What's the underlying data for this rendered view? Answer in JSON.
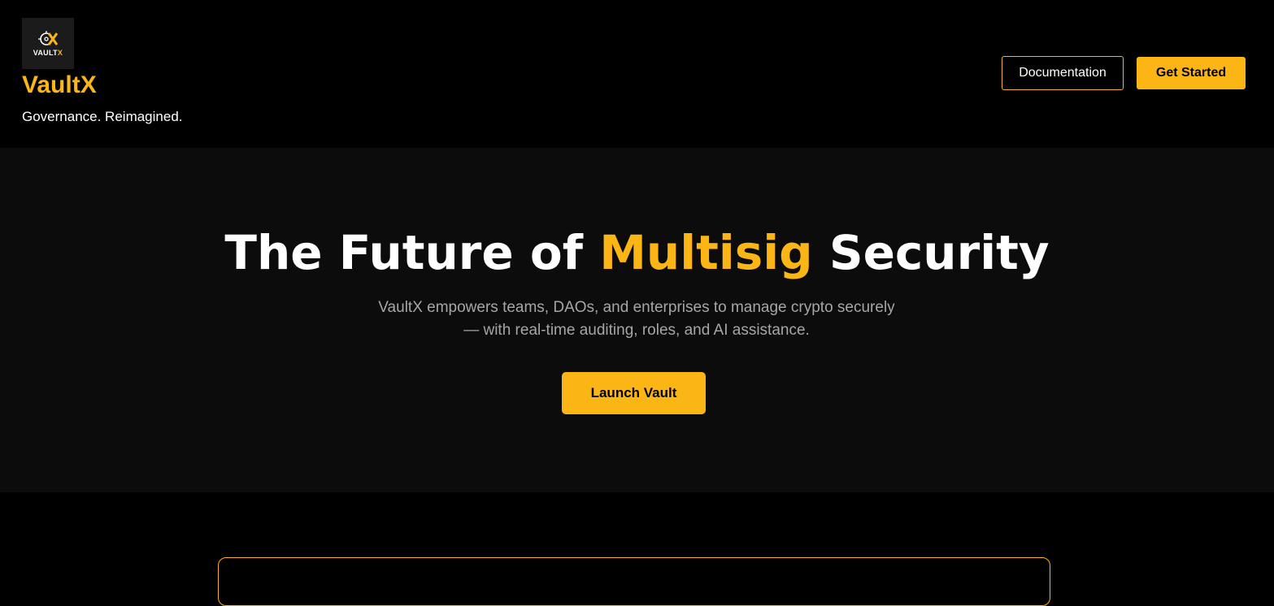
{
  "header": {
    "logo": {
      "icon": "vaultx-logo-icon",
      "text_main": "VAULT",
      "text_accent": "X"
    },
    "brand_name": "VaultX",
    "tagline": "Governance. Reimagined.",
    "nav": {
      "documentation_label": "Documentation",
      "get_started_label": "Get Started"
    }
  },
  "hero": {
    "title_before": "The Future of ",
    "title_accent": "Multisig",
    "title_after": " Security",
    "subtitle_line1": "VaultX empowers teams, DAOs, and enterprises to manage crypto securely",
    "subtitle_line2": "— with real-time auditing, roles, and AI assistance.",
    "cta_label": "Launch Vault"
  },
  "colors": {
    "accent": "#fbb615",
    "background": "#000000",
    "hero_background": "#0c0c0c",
    "subtitle_text": "#a6a6a6"
  }
}
